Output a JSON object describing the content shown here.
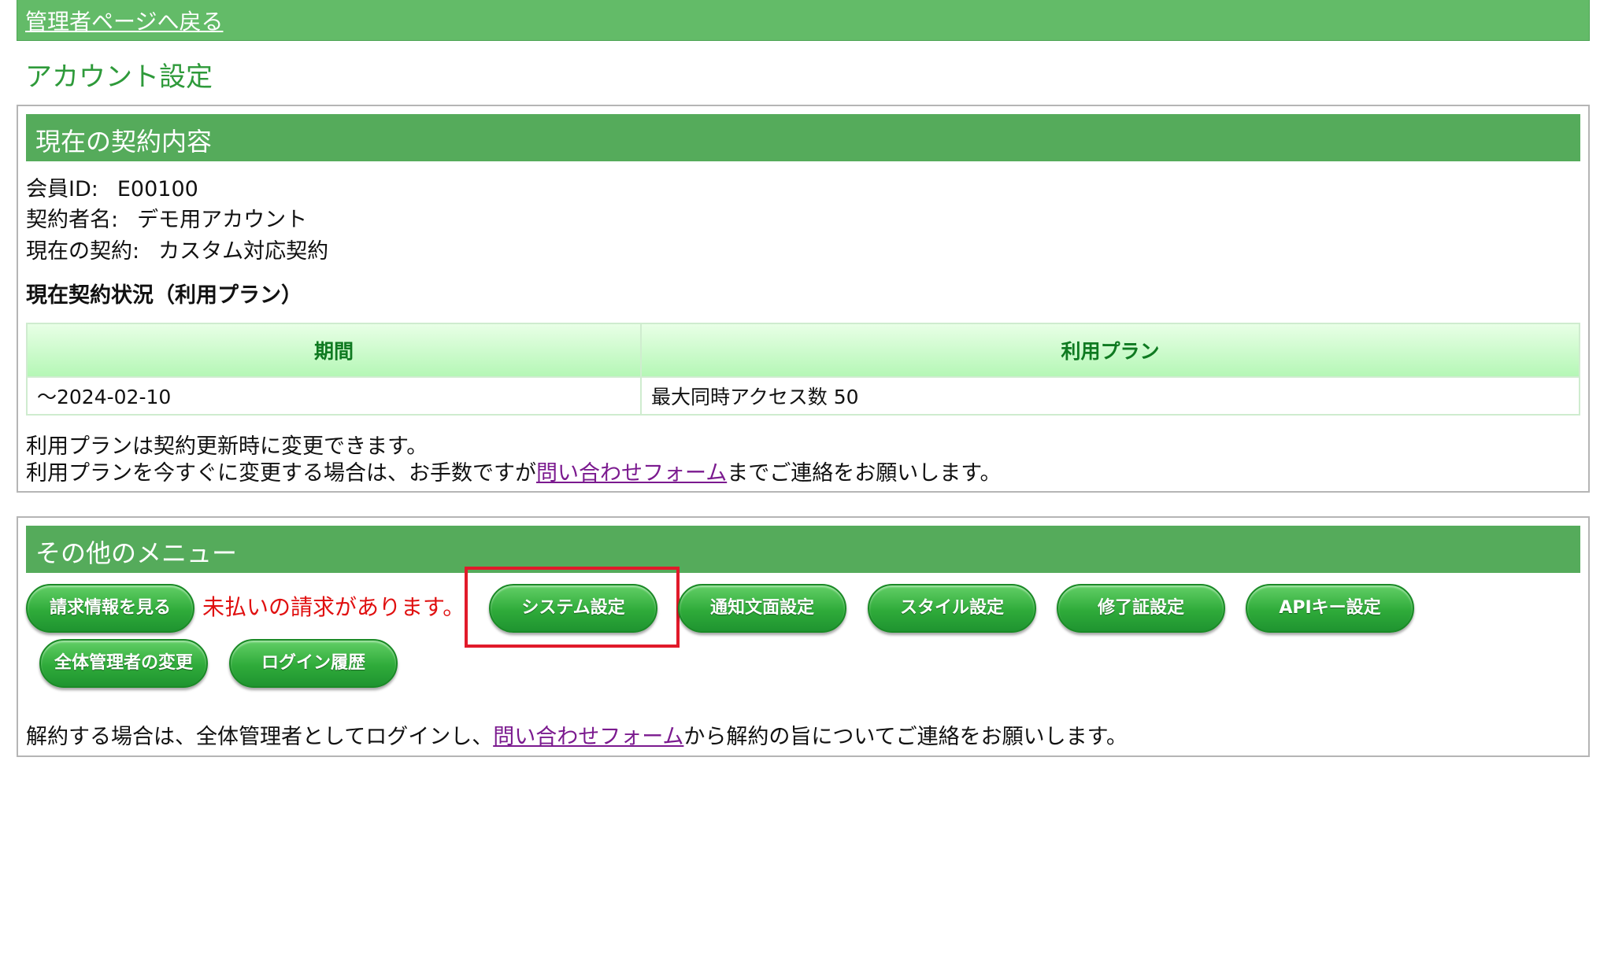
{
  "nav": {
    "back_link": "管理者ページへ戻る"
  },
  "page": {
    "title": "アカウント設定"
  },
  "contract": {
    "header": "現在の契約内容",
    "member_id_label": "会員ID:",
    "member_id": "E00100",
    "contractor_label": "契約者名:",
    "contractor": "デモ用アカウント",
    "current_contract_label": "現在の契約:",
    "current_contract": "カスタム対応契約",
    "status_heading": "現在契約状況（利用プラン）",
    "table": {
      "columns": [
        "期間",
        "利用プラン"
      ],
      "rows": [
        [
          "～2024-02-10",
          "最大同時アクセス数 50"
        ]
      ]
    },
    "note_line1": "利用プランは契約更新時に変更できます。",
    "note_line2_prefix": "利用プランを今すぐに変更する場合は、お手数ですが",
    "note_line2_link": "問い合わせフォーム",
    "note_line2_suffix": "までご連絡をお願いします。"
  },
  "menu": {
    "header": "その他のメニュー",
    "buttons": {
      "billing": "請求情報を見る",
      "system": "システム設定",
      "notification": "通知文面設定",
      "style": "スタイル設定",
      "certificate": "修了証設定",
      "api_key": "APIキー設定",
      "change_admin": "全体管理者の変更",
      "login_history": "ログイン履歴"
    },
    "unpaid_notice": "未払いの請求があります。",
    "cancel_prefix": "解約する場合は、全体管理者としてログインし、",
    "cancel_link": "問い合わせフォーム",
    "cancel_suffix": "から解約の旨についてご連絡をお願いします。"
  },
  "colors": {
    "header_green": "#55ab5b",
    "top_bar_green": "#63bb68",
    "title_green": "#2e9a3a",
    "link_purple": "#7b1a8f",
    "alert_red": "#e01010",
    "highlight_red": "#e11a2a"
  }
}
